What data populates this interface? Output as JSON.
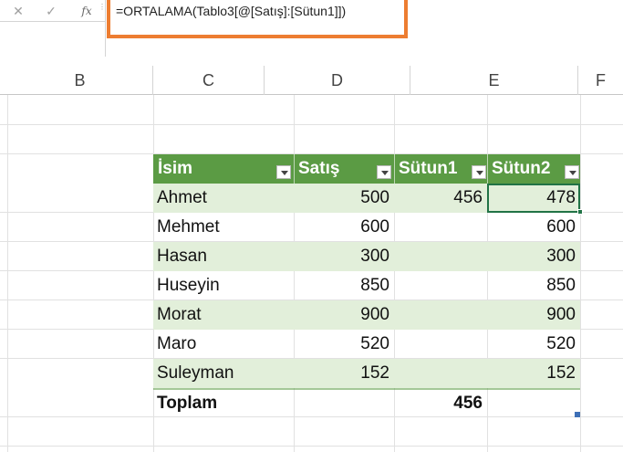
{
  "formula_bar": {
    "cancel_glyph": "✕",
    "enter_glyph": "✓",
    "fx_label": "fx",
    "formula": "=ORTALAMA(Tablo3[@[Satış]:[Sütun1]])"
  },
  "columns": [
    "B",
    "C",
    "D",
    "E",
    "F"
  ],
  "table": {
    "headers": [
      "İsim",
      "Satış",
      "Sütun1",
      "Sütun2"
    ],
    "rows": [
      {
        "isim": "Ahmet",
        "satis": "500",
        "sutun1": "456",
        "sutun2": "478"
      },
      {
        "isim": "Mehmet",
        "satis": "600",
        "sutun1": "",
        "sutun2": "600"
      },
      {
        "isim": "Hasan",
        "satis": "300",
        "sutun1": "",
        "sutun2": "300"
      },
      {
        "isim": "Huseyin",
        "satis": "850",
        "sutun1": "",
        "sutun2": "850"
      },
      {
        "isim": "Morat",
        "satis": "900",
        "sutun1": "",
        "sutun2": "900"
      },
      {
        "isim": "Maro",
        "satis": "520",
        "sutun1": "",
        "sutun2": "520"
      },
      {
        "isim": "Suleyman",
        "satis": "152",
        "sutun1": "",
        "sutun2": "152"
      }
    ],
    "total": {
      "label": "Toplam",
      "satis": "",
      "sutun1": "456",
      "sutun2": ""
    }
  },
  "colors": {
    "header_green": "#5b9b44",
    "band_green": "#e2efda",
    "highlight_orange": "#ed7d31",
    "selection_green": "#217346"
  }
}
